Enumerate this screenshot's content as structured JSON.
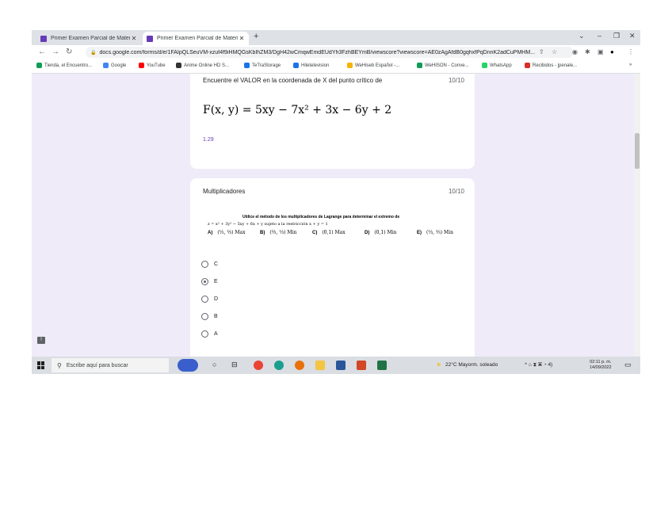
{
  "browser": {
    "tabs": [
      {
        "title": "Primer Examen Parcial de Matem"
      },
      {
        "title": "Primer Examen Parcial de Matem"
      }
    ],
    "url": "docs.google.com/forms/d/e/1FAIpQLSeuVM-xzuf4f9iHMQGsKbIhZM3/DgH42wCmqwEmdEUdYh3FzhBEYmB/viewscore?viewscore=AE0zAgAfdB0gqhxfPqDnnK2adCuPMHM...",
    "bookmarks": [
      {
        "label": "Tienda, el Encuentro...",
        "color": "#0f9d58"
      },
      {
        "label": "Google",
        "color": "#4285f4"
      },
      {
        "label": "YouTube",
        "color": "#ff0000"
      },
      {
        "label": "Anime Online HD S...",
        "color": "#333333"
      },
      {
        "label": "TeTraStorage",
        "color": "#1a73e8"
      },
      {
        "label": "Hiletelevision",
        "color": "#1a73e8"
      },
      {
        "label": "WeHiseb Español -...",
        "color": "#f4b400"
      },
      {
        "label": "WeHISON - Conve...",
        "color": "#0f9d58"
      },
      {
        "label": "WhatsApp",
        "color": "#25d366"
      },
      {
        "label": "Recibidos - jpenale...",
        "color": "#d93025"
      }
    ],
    "more": "»"
  },
  "questions": [
    {
      "title": "Encuentre el VALOR en la coordenada de  X  del punto crítico de",
      "points": "10/10",
      "formula": "F(x, y) = 5xy − 7x² + 3x − 6y + 2",
      "answer": "1.29"
    },
    {
      "title": "Multiplicadores",
      "points": "10/10",
      "statement": "Utilice el método de los multiplicadores de Lagrange para determinar el extremo de",
      "function_line": "z = x² + 3y² − 5xy + 6x + y  sujeto a la restricción  x + y = 1",
      "choices": [
        {
          "letter": "A)",
          "value": "(⅓, ⅔) Max"
        },
        {
          "letter": "B)",
          "value": "(⅔, ⅓) Min"
        },
        {
          "letter": "C)",
          "value": "(0,1) Max"
        },
        {
          "letter": "D)",
          "value": "(0,1) Min"
        },
        {
          "letter": "E)",
          "value": "(⅓, ⅔) Min"
        }
      ],
      "options": [
        {
          "label": "C",
          "selected": false
        },
        {
          "label": "E",
          "selected": true
        },
        {
          "label": "D",
          "selected": false
        },
        {
          "label": "B",
          "selected": false
        },
        {
          "label": "A",
          "selected": false
        }
      ]
    }
  ],
  "taskbar": {
    "search_placeholder": "Escribe aquí para buscar",
    "weather": "22°C  Mayorm. soleado",
    "tray_icons": "^ ⌂ ⧗ ▣ ◔ 4)",
    "time": "02:11 p. m.",
    "date": "14/09/2022"
  }
}
